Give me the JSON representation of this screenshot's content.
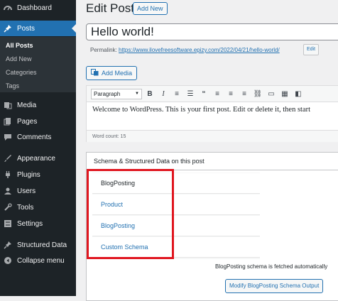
{
  "sidebar": {
    "items": [
      {
        "label": "Dashboard",
        "icon": "dashboard-icon"
      },
      {
        "label": "Posts",
        "icon": "pin-icon"
      },
      {
        "label": "Media",
        "icon": "media-icon"
      },
      {
        "label": "Pages",
        "icon": "pages-icon"
      },
      {
        "label": "Comments",
        "icon": "comments-icon"
      },
      {
        "label": "Appearance",
        "icon": "appearance-icon"
      },
      {
        "label": "Plugins",
        "icon": "plugins-icon"
      },
      {
        "label": "Users",
        "icon": "users-icon"
      },
      {
        "label": "Tools",
        "icon": "tools-icon"
      },
      {
        "label": "Settings",
        "icon": "settings-icon"
      },
      {
        "label": "Structured Data",
        "icon": "pin-icon"
      },
      {
        "label": "Collapse menu",
        "icon": "collapse-icon"
      }
    ],
    "submenu": [
      "All Posts",
      "Add New",
      "Categories",
      "Tags"
    ]
  },
  "header": {
    "title": "Edit Post",
    "add_new": "Add New"
  },
  "post": {
    "title": "Hello world!",
    "permalink_label": "Permalink:",
    "permalink_url": "https://www.ilovefreesoftware.epizy.com/2022/04/21/hello-world/",
    "edit_label": "Edit"
  },
  "add_media": "Add Media",
  "editor": {
    "format": "Paragraph",
    "content": "Welcome to WordPress. This is your first post. Edit or delete it, then start",
    "word_count": "Word count: 15"
  },
  "schema": {
    "header": "Schema & Structured Data on this post",
    "tabs": [
      "BlogPosting",
      "Product",
      "BlogPosting",
      "Custom Schema"
    ],
    "note": "BlogPosting schema is fetched automatically",
    "modify_button": "Modify BlogPosting Schema Output"
  },
  "colors": {
    "accent": "#2271b1",
    "highlight": "#e0161f",
    "sidebar": "#1d2327"
  }
}
